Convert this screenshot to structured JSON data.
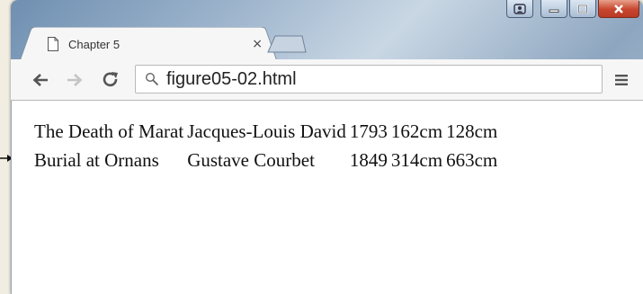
{
  "browser": {
    "tab": {
      "title": "Chapter 5",
      "close_glyph": "×"
    },
    "address_bar": {
      "value": "figure05-02.html"
    },
    "icons": {
      "back": "arrow-left-icon",
      "forward": "arrow-right-icon",
      "reload": "reload-icon",
      "menu": "hamburger-menu-icon",
      "search": "search-icon",
      "page": "page-icon"
    }
  },
  "page": {
    "rows": [
      {
        "title": "The Death of Marat",
        "artist": "Jacques-Louis David",
        "year": "1793",
        "width": "162cm",
        "height": "128cm"
      },
      {
        "title": "Burial at Ornans",
        "artist": "Gustave Courbet",
        "year": "1849",
        "width": "314cm",
        "height": "663cm"
      }
    ]
  },
  "colors": {
    "window_frame": "#8ea6c0",
    "close_button": "#c8462e",
    "toolbar": "#f6f6f6",
    "page_background": "#ffffff"
  }
}
